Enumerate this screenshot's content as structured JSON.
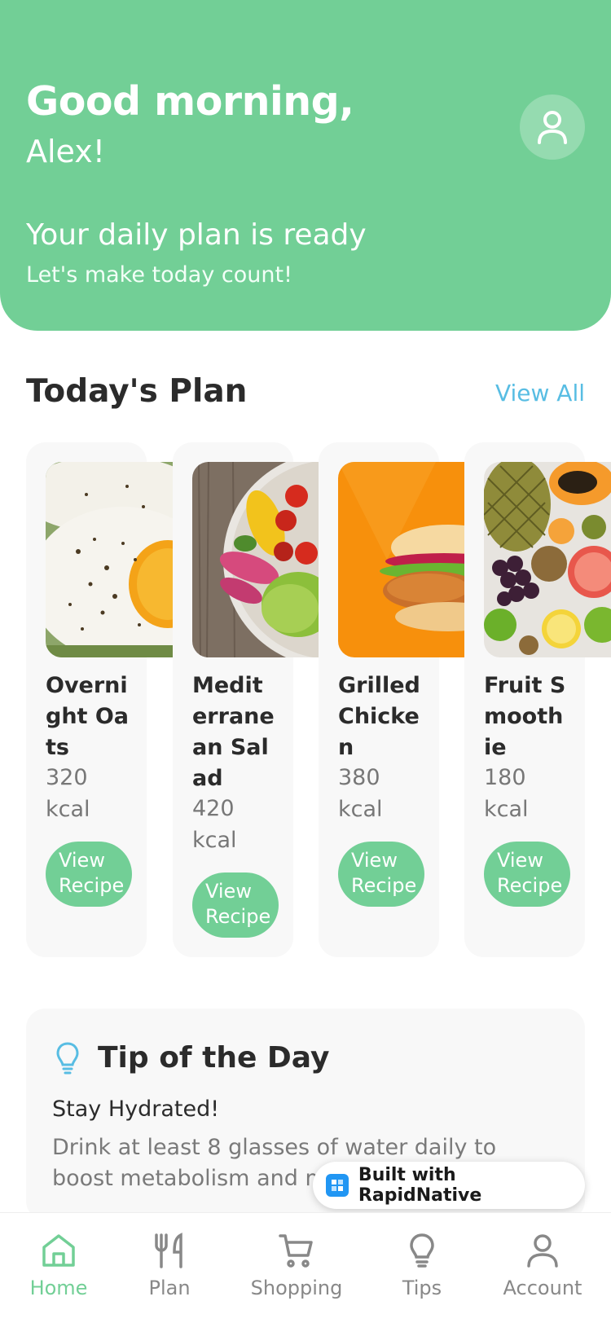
{
  "header": {
    "greeting": "Good morning,",
    "name": "Alex!",
    "plan_ready": "Your daily plan is ready",
    "motivation": "Let's make today count!"
  },
  "todays_plan": {
    "title": "Today's Plan",
    "view_all": "View All",
    "meals": [
      {
        "title": "Overnight Oats",
        "kcal": "320 kcal",
        "button": "View Recipe",
        "image": "fried-eggs-photo"
      },
      {
        "title": "Mediterranean Salad",
        "kcal": "420 kcal",
        "button": "View Recipe",
        "image": "salad-bowl-photo"
      },
      {
        "title": "Grilled Chicken",
        "kcal": "380 kcal",
        "button": "View Recipe",
        "image": "chicken-burger-photo"
      },
      {
        "title": "Fruit Smoothie",
        "kcal": "180 kcal",
        "button": "View Recipe",
        "image": "fruit-platter-photo"
      }
    ]
  },
  "tip": {
    "icon": "lightbulb-icon",
    "title": "Tip of the Day",
    "subtitle": "Stay Hydrated!",
    "body": "Drink at least 8 glasses of water daily to boost metabolism and maintain"
  },
  "badge": {
    "label": "Built with RapidNative"
  },
  "tabs": [
    {
      "label": "Home",
      "icon": "home-icon",
      "active": true
    },
    {
      "label": "Plan",
      "icon": "utensils-icon",
      "active": false
    },
    {
      "label": "Shopping",
      "icon": "cart-icon",
      "active": false
    },
    {
      "label": "Tips",
      "icon": "lightbulb-icon",
      "active": false
    },
    {
      "label": "Account",
      "icon": "user-icon",
      "active": false
    }
  ],
  "colors": {
    "primary": "#72cf96",
    "accent": "#58bde3",
    "card": "#f8f8f8"
  }
}
